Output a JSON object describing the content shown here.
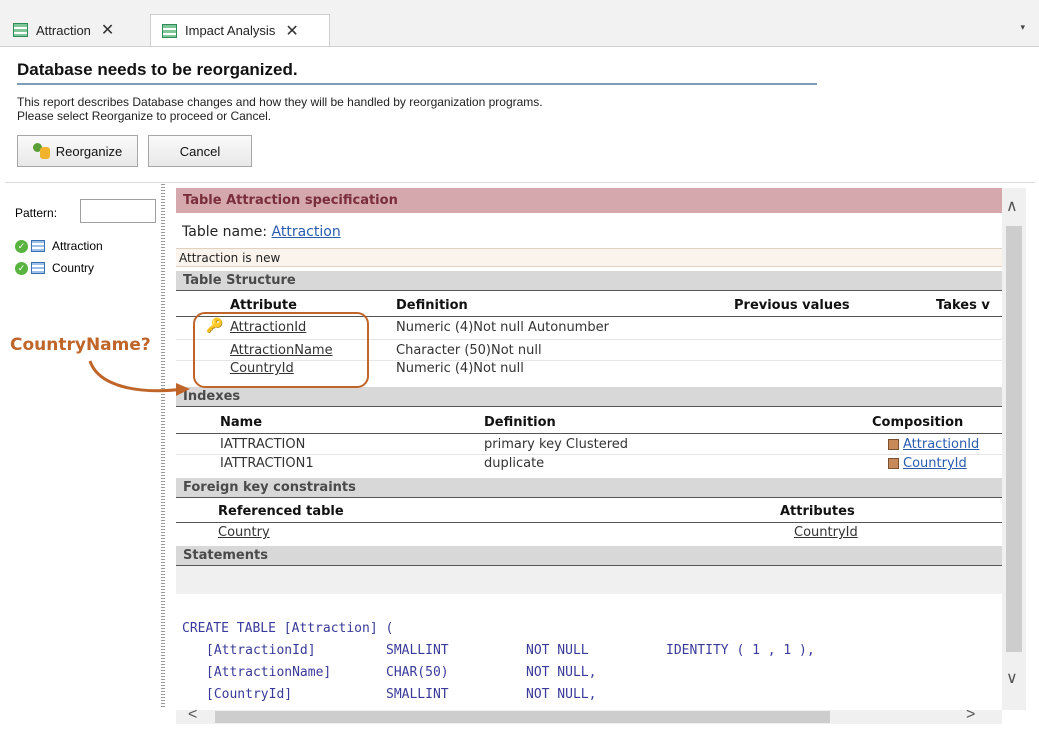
{
  "tabs": [
    {
      "label": "Attraction",
      "close": "✕"
    },
    {
      "label": "Impact Analysis",
      "close": "✕"
    }
  ],
  "tab_menu": "▾",
  "header": {
    "title": "Database needs to be reorganized.",
    "desc1": "This report describes Database changes and how they will be handled by reorganization programs.",
    "desc2": "Please select Reorganize to proceed or Cancel."
  },
  "buttons": {
    "reorganize": "Reorganize",
    "cancel": "Cancel"
  },
  "left": {
    "pattern_label": "Pattern:",
    "pattern_value": "",
    "items": [
      "Attraction",
      "Country"
    ]
  },
  "report": {
    "spec_title": "Table Attraction specification",
    "table_name_label": "Table name: ",
    "table_name_link": "Attraction",
    "is_new": "Attraction is new",
    "structure": {
      "title": "Table Structure",
      "headers": [
        "Attribute",
        "Definition",
        "Previous values",
        "Takes v"
      ],
      "rows": [
        {
          "attr": "AttractionId",
          "def": "Numeric (4)Not null Autonumber"
        },
        {
          "attr": "AttractionName",
          "def": "Character (50)Not null"
        },
        {
          "attr": "CountryId",
          "def": "Numeric (4)Not null"
        }
      ]
    },
    "indexes": {
      "title": "Indexes",
      "headers": [
        "Name",
        "Definition",
        "Composition"
      ],
      "rows": [
        {
          "name": "IATTRACTION",
          "def": "primary key Clustered",
          "comp": "AttractionId"
        },
        {
          "name": "IATTRACTION1",
          "def": "duplicate",
          "comp": "CountryId"
        }
      ]
    },
    "fk": {
      "title": "Foreign key constraints",
      "headers": [
        "Referenced table",
        "Attributes"
      ],
      "rows": [
        {
          "table": "Country",
          "attrs": "CountryId"
        }
      ]
    },
    "statements": {
      "title": "Statements",
      "create": "CREATE TABLE [Attraction] (",
      "lines": [
        {
          "id": "[AttractionId]",
          "type": "SMALLINT",
          "nn": "NOT NULL",
          "extra": "IDENTITY ( 1 , 1 ),"
        },
        {
          "id": "[AttractionName]",
          "type": "CHAR(50)",
          "nn": "NOT NULL,",
          "extra": ""
        },
        {
          "id": "[CountryId]",
          "type": "SMALLINT",
          "nn": "NOT NULL,",
          "extra": ""
        }
      ]
    }
  },
  "annotation": {
    "label": "CountryName?",
    "color": "#c0652a"
  },
  "scroll": {
    "up": "∧",
    "down": "∨",
    "left": "<",
    "right": ">"
  }
}
